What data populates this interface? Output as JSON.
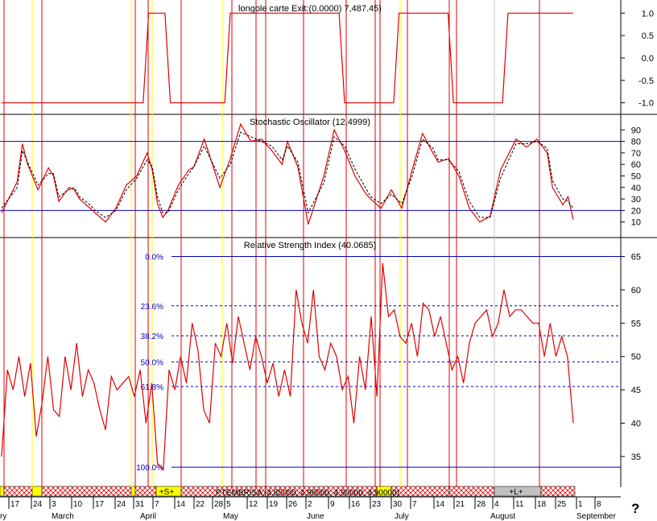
{
  "colors": {
    "price": "#e00000",
    "vline": "#e00000",
    "yline": "#ffff00",
    "gline": "#c0c0c0",
    "axis": "#000000",
    "level": "#0000c0",
    "fib": "#0000c0",
    "bandYellow": "#ffff00",
    "bandHatch": "#e00000",
    "bandGray": "#c0c0c0"
  },
  "help_label": "?",
  "chart_data": [
    {
      "type": "line",
      "title": "longole carte Exit:(0.0000) 7,487.45)",
      "ylim": [
        -1.15,
        1.15
      ],
      "y_ticks": [
        "1.0",
        "0.5",
        "0.0",
        "-0.5",
        "-1.0"
      ],
      "y_tick_values": [
        1.0,
        0.5,
        0.0,
        -0.5,
        -1.0
      ],
      "series": [
        {
          "x": [
            0,
            26,
            27,
            30,
            31,
            41,
            42,
            62,
            63,
            72,
            73,
            82,
            83,
            92,
            93,
            105
          ],
          "y": [
            -1,
            -1,
            1,
            1,
            -1,
            -1,
            1,
            1,
            -1,
            -1,
            1,
            1,
            -1,
            -1,
            1,
            1
          ]
        }
      ]
    },
    {
      "type": "line",
      "title": "Stochastic Oscillator (12.4999)",
      "ylim": [
        0,
        100
      ],
      "y_ticks": [
        "90",
        "80",
        "70",
        "60",
        "50",
        "40",
        "30",
        "20",
        "10"
      ],
      "y_tick_values": [
        90,
        80,
        70,
        60,
        50,
        40,
        30,
        20,
        10
      ],
      "levels": [
        80,
        20
      ],
      "series": [
        {
          "style": "solid",
          "values": [
            18,
            45,
            78,
            60,
            38,
            57,
            50,
            28,
            40,
            38,
            30,
            22,
            18,
            10,
            22,
            42,
            50,
            70,
            55,
            26,
            14,
            20,
            42,
            55,
            58,
            82,
            40,
            65,
            95,
            80,
            82,
            72,
            60,
            80,
            58,
            8,
            50,
            90,
            72,
            50,
            35,
            30,
            22,
            38,
            22,
            55,
            87,
            70,
            62,
            65,
            50,
            22,
            10,
            15,
            55,
            82,
            75,
            82,
            70,
            40,
            25,
            32,
            12
          ],
          "x": [
            0,
            3,
            4,
            5,
            7,
            9,
            10,
            11,
            13,
            14,
            15,
            17,
            18,
            20,
            22,
            24,
            26,
            28,
            29,
            30,
            31,
            32,
            34,
            36,
            37,
            39,
            42,
            44,
            46,
            48,
            50,
            52,
            54,
            55,
            57,
            59,
            62,
            64,
            66,
            68,
            70,
            71,
            73,
            75,
            77,
            79,
            81,
            83,
            84,
            86,
            88,
            90,
            92,
            94,
            96,
            99,
            101,
            103,
            105,
            106,
            108,
            109,
            110
          ]
        },
        {
          "style": "dashed",
          "values": [
            22,
            40,
            72,
            62,
            42,
            52,
            52,
            32,
            38,
            40,
            32,
            25,
            20,
            14,
            20,
            38,
            48,
            64,
            58,
            32,
            18,
            18,
            38,
            52,
            58,
            76,
            48,
            60,
            88,
            84,
            80,
            76,
            64,
            76,
            62,
            18,
            44,
            84,
            76,
            56,
            40,
            32,
            26,
            34,
            26,
            50,
            82,
            74,
            64,
            64,
            54,
            28,
            14,
            14,
            48,
            78,
            78,
            80,
            74,
            46,
            30,
            28,
            22
          ],
          "x": [
            0,
            3,
            4,
            5,
            7,
            9,
            10,
            11,
            13,
            14,
            15,
            17,
            18,
            20,
            22,
            24,
            26,
            28,
            29,
            30,
            31,
            32,
            34,
            36,
            37,
            39,
            42,
            44,
            46,
            48,
            50,
            52,
            54,
            55,
            57,
            59,
            62,
            64,
            66,
            68,
            70,
            71,
            73,
            75,
            77,
            79,
            81,
            83,
            84,
            86,
            88,
            90,
            92,
            94,
            96,
            99,
            101,
            103,
            105,
            106,
            108,
            109,
            110
          ]
        }
      ]
    },
    {
      "type": "line",
      "title": "Relative Strength Index (40.0685)",
      "ylim": [
        31,
        67
      ],
      "y_ticks": [
        "65",
        "60",
        "55",
        "50",
        "45",
        "40",
        "35"
      ],
      "y_tick_values": [
        65,
        60,
        55,
        50,
        45,
        40,
        35
      ],
      "fib_levels": [
        {
          "label": "0.0%",
          "value": 65
        },
        {
          "label": "23.6%",
          "value": 57.6
        },
        {
          "label": "38.2%",
          "value": 53.1
        },
        {
          "label": "50.0%",
          "value": 49.2
        },
        {
          "label": "61.8%",
          "value": 45.5
        },
        {
          "label": "100.0%",
          "value": 33.4
        }
      ],
      "series": [
        {
          "values": [
            35,
            48,
            45,
            50,
            44,
            49,
            38,
            43,
            50,
            42,
            41,
            50,
            45,
            52,
            44,
            48,
            46,
            42,
            39,
            47,
            45,
            46,
            47,
            44,
            48,
            40,
            46,
            34,
            33,
            48,
            45,
            50,
            46,
            55,
            51,
            42,
            40,
            52,
            50,
            55,
            49,
            56,
            52,
            48,
            53,
            50,
            46,
            49,
            44,
            48,
            44,
            60,
            55,
            52,
            60,
            50,
            48,
            52,
            50,
            45,
            47,
            40,
            50,
            45,
            56,
            44,
            64,
            56,
            57,
            53,
            52,
            55,
            50,
            58,
            57,
            53,
            56,
            52,
            48,
            50,
            46,
            52,
            55,
            56,
            57,
            53,
            55,
            60,
            56,
            57,
            57,
            56,
            55,
            55,
            50,
            55,
            50,
            53,
            50,
            40
          ],
          "x": [
            0,
            1,
            2,
            3,
            4,
            5,
            6,
            7,
            8,
            9,
            10,
            11,
            12,
            13,
            14,
            15,
            16,
            17,
            18,
            19,
            20,
            21,
            22,
            23,
            24,
            25,
            26,
            27,
            28,
            29,
            30,
            31,
            32,
            33,
            34,
            35,
            36,
            37,
            38,
            39,
            40,
            41,
            42,
            43,
            44,
            45,
            46,
            47,
            48,
            49,
            50,
            51,
            52,
            53,
            54,
            55,
            56,
            57,
            58,
            59,
            60,
            61,
            62,
            63,
            64,
            65,
            66,
            67,
            68,
            69,
            70,
            71,
            72,
            73,
            74,
            75,
            76,
            77,
            78,
            79,
            80,
            81,
            82,
            83,
            84,
            85,
            86,
            87,
            88,
            89,
            90,
            91,
            92,
            93,
            94,
            95,
            96,
            97,
            98,
            99
          ]
        }
      ]
    }
  ],
  "bottom_band": {
    "markers": [
      "+S+",
      "+L+"
    ],
    "overlay_text": "PTEMBRISA (4.85000, 4.96000, 4.90000, 4.90000)"
  },
  "x_axis": {
    "day_labels": [
      "17",
      "24",
      "3",
      "10",
      "17",
      "24",
      "31",
      "7",
      "14",
      "22",
      "28",
      "5",
      "12",
      "19",
      "26",
      "2",
      "9",
      "16",
      "23",
      "30",
      "7",
      "14",
      "21",
      "28",
      "4",
      "11",
      "18",
      "25",
      "1",
      "8"
    ],
    "month_labels": [
      "ry",
      "March",
      "April",
      "May",
      "June",
      "July",
      "August",
      "September"
    ]
  }
}
